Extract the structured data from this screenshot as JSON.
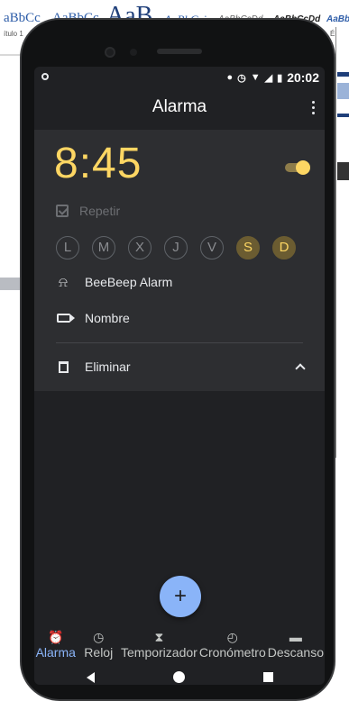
{
  "background": {
    "style_samples": [
      "aBbCc",
      "AaBbCc",
      "AaB",
      "AaBbCci",
      "AaBbCcDd",
      "AaBbCcDd",
      "AaBb"
    ],
    "sub_left": "ítulo 1",
    "sub_right": "Énf"
  },
  "status_bar": {
    "time": "20:02"
  },
  "app_bar": {
    "title": "Alarma"
  },
  "alarm": {
    "time": "8:45",
    "enabled": true,
    "repeat_label": "Repetir",
    "days": [
      {
        "label": "L",
        "selected": false
      },
      {
        "label": "M",
        "selected": false
      },
      {
        "label": "X",
        "selected": false
      },
      {
        "label": "J",
        "selected": false
      },
      {
        "label": "V",
        "selected": false
      },
      {
        "label": "S",
        "selected": true
      },
      {
        "label": "D",
        "selected": true
      }
    ],
    "sound_label": "BeeBeep Alarm",
    "name_label": "Nombre",
    "delete_label": "Eliminar"
  },
  "fab": {
    "label": "+"
  },
  "bottom_nav": [
    {
      "label": "Alarma",
      "icon": "alarm-clock-icon",
      "active": true
    },
    {
      "label": "Reloj",
      "icon": "clock-icon",
      "active": false
    },
    {
      "label": "Temporizador",
      "icon": "hourglass-icon",
      "active": false
    },
    {
      "label": "Cronómetro",
      "icon": "stopwatch-icon",
      "active": false
    },
    {
      "label": "Descanso",
      "icon": "bed-icon",
      "active": false
    }
  ],
  "colors": {
    "accent": "#fdd663",
    "nav_active": "#8ab4f8",
    "screen_bg": "#202124",
    "card_bg": "#2d2e31"
  }
}
